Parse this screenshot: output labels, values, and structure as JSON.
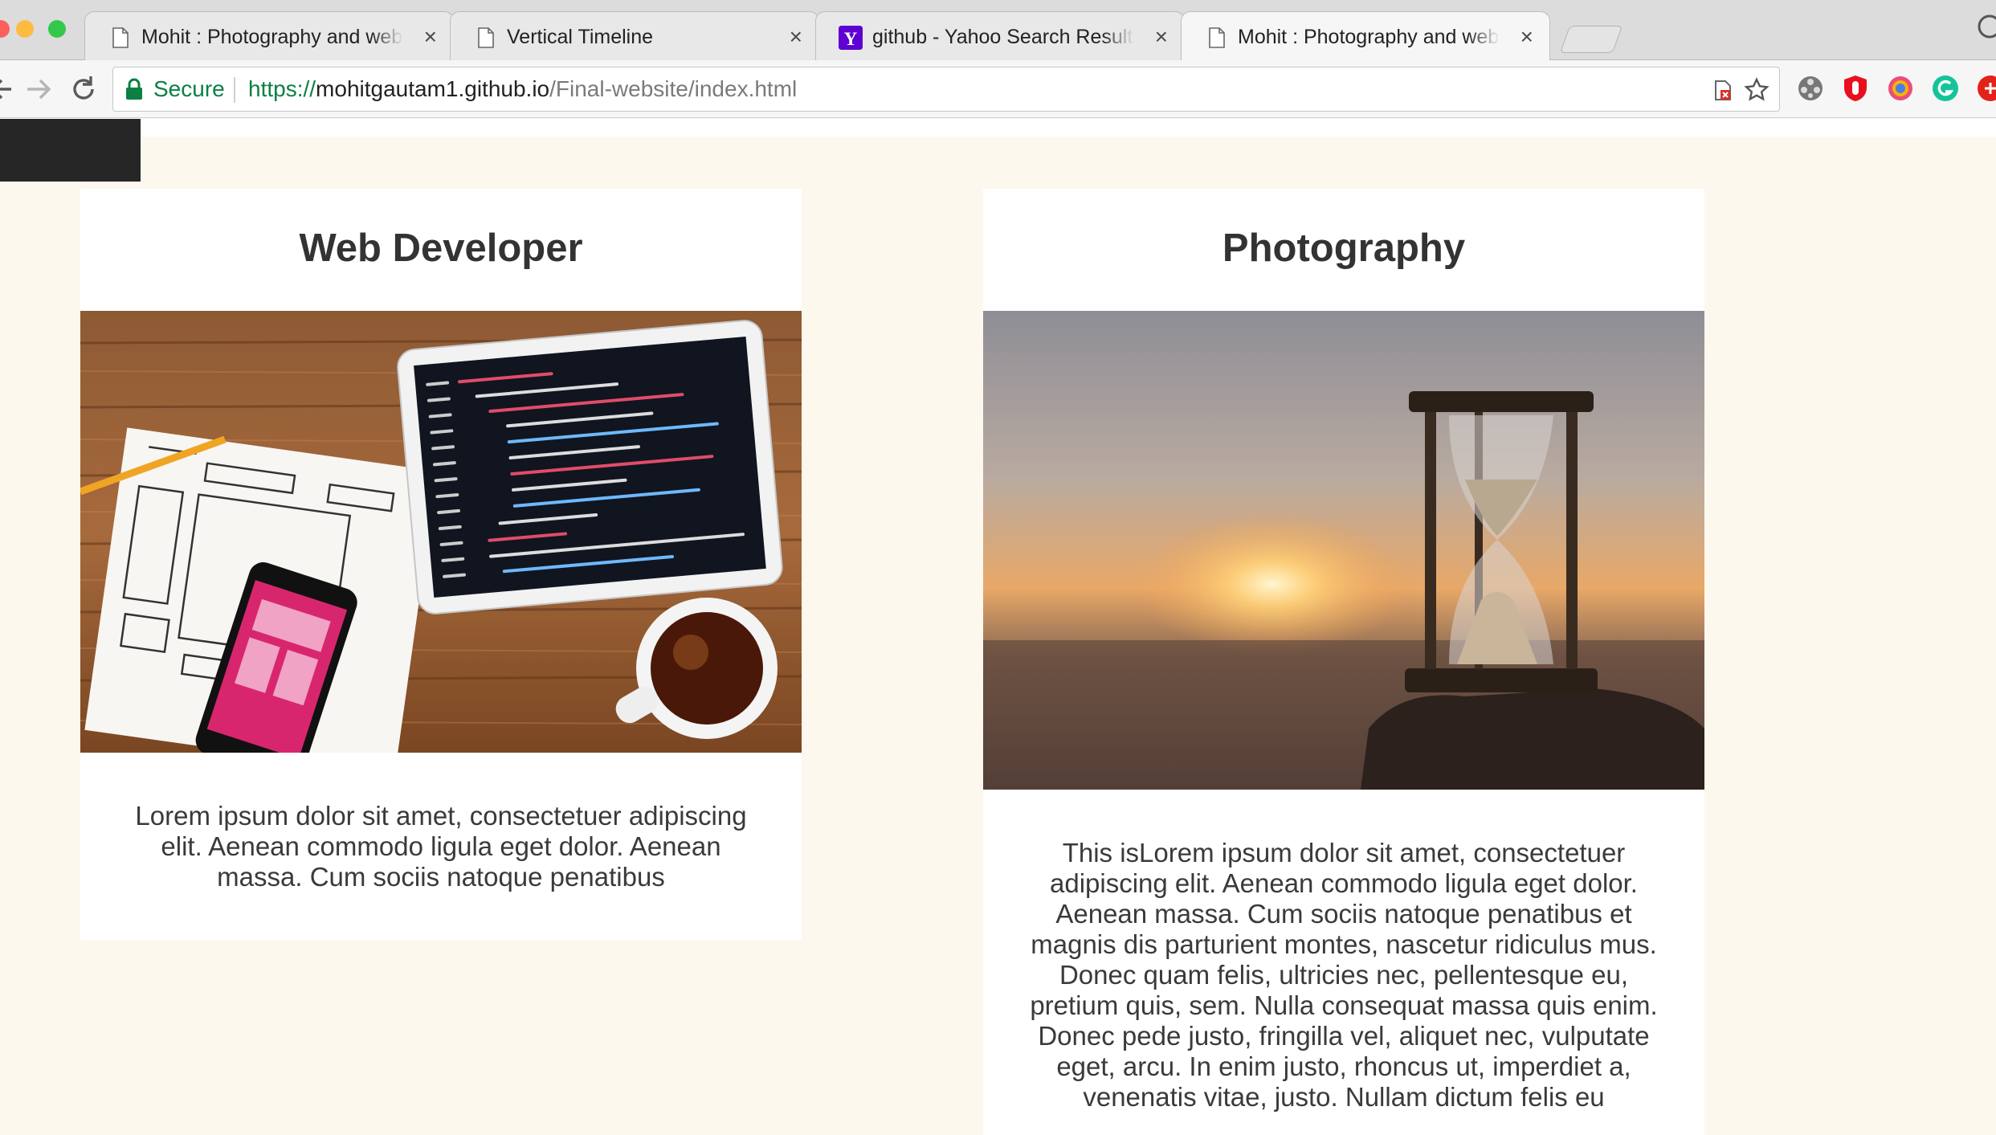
{
  "browser": {
    "tabs": [
      {
        "title": "Mohit : Photography and web developer",
        "favicon": "page-icon",
        "active": false
      },
      {
        "title": "Vertical Timeline",
        "favicon": "page-icon",
        "active": false
      },
      {
        "title": "github - Yahoo Search Results",
        "favicon": "yahoo-icon",
        "active": false
      },
      {
        "title": "Mohit : Photography and web developer",
        "favicon": "page-icon",
        "active": true
      }
    ],
    "close_glyph": "×",
    "address": {
      "secure_label": "Secure",
      "scheme": "https://",
      "host": "mohitgautam1.github.io",
      "path": "/Final-website/index.html"
    },
    "extensions": [
      "film-reel-icon",
      "ublock-icon",
      "chrome-ext-icon",
      "grammarly-icon",
      "red-ext-icon"
    ]
  },
  "page": {
    "cards": [
      {
        "title": "Web Developer",
        "image": "desk-with-tablet-code-and-wireframe",
        "text": "Lorem ipsum dolor sit amet, consectetuer adipiscing elit. Aenean commodo ligula eget dolor. Aenean massa. Cum sociis natoque penatibus"
      },
      {
        "title": "Photography",
        "image": "hourglass-at-sunset-beach",
        "text": "This isLorem ipsum dolor sit amet, consectetuer adipiscing elit. Aenean commodo ligula eget dolor. Aenean massa. Cum sociis natoque penatibus et magnis dis parturient montes, nascetur ridiculus mus. Donec quam felis, ultricies nec, pellentesque eu, pretium quis, sem. Nulla consequat massa quis enim. Donec pede justo, fringilla vel, aliquet nec, vulputate eget, arcu. In enim justo, rhoncus ut, imperdiet a, venenatis vitae, justo. Nullam dictum felis eu"
      }
    ],
    "colors": {
      "background": "#fdf8ee",
      "card": "#ffffff",
      "heading": "#333333",
      "secure_green": "#0b8043"
    }
  }
}
